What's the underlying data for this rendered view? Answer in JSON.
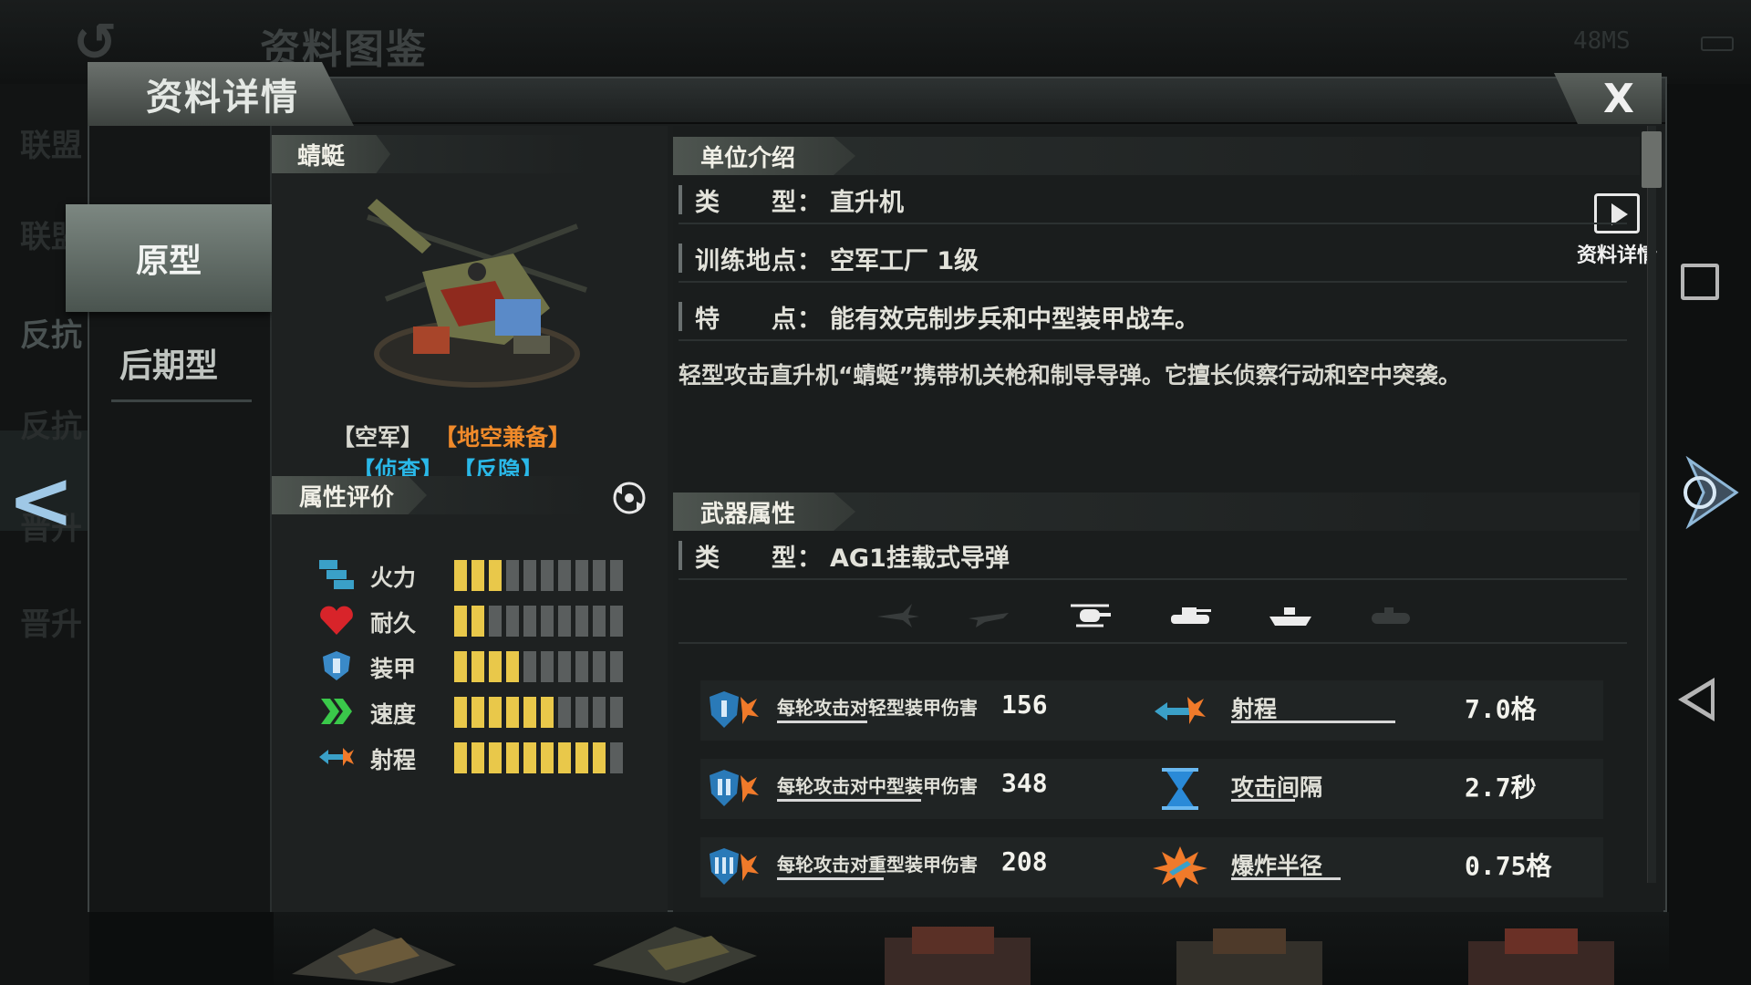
{
  "background": {
    "screen_title": "资料图鉴",
    "status_text": "48MS",
    "left_items": [
      "联盟",
      "联盟",
      "反抗",
      "反抗",
      "晋升",
      "晋升"
    ]
  },
  "panel": {
    "title": "资料详情",
    "close_label": "X"
  },
  "tabs": {
    "prototype": "原型",
    "later": "后期型"
  },
  "unit": {
    "name": "蜻蜓",
    "tags": [
      {
        "text": "【空军】",
        "color": "#f2f2ea"
      },
      {
        "text": "【地空兼备】",
        "color": "#f08a2a"
      },
      {
        "text": "【侦查】",
        "color": "#2ab8e8"
      },
      {
        "text": "【反隐】",
        "color": "#2ab8e8"
      }
    ],
    "rating_title": "属性评价",
    "stats": [
      {
        "label": "火力",
        "icon": "firepower-icon",
        "filled": 3,
        "total": 10
      },
      {
        "label": "耐久",
        "icon": "heart-icon",
        "filled": 2,
        "total": 10
      },
      {
        "label": "装甲",
        "icon": "armor-shield-icon",
        "filled": 4,
        "total": 10
      },
      {
        "label": "速度",
        "icon": "speed-chevron-icon",
        "filled": 6,
        "total": 10
      },
      {
        "label": "射程",
        "icon": "range-arrow-icon",
        "filled": 9,
        "total": 10
      }
    ]
  },
  "intro": {
    "title": "单位介绍",
    "detail_button": "资料详情",
    "rows": [
      {
        "key": "类　　型：",
        "value": "直升机"
      },
      {
        "key": "训练地点：",
        "value": "空军工厂 1级"
      },
      {
        "key": "特　　点：",
        "value": "能有效克制步兵和中型装甲战车。"
      }
    ],
    "description": "轻型攻击直升机“蜻蜓”携带机关枪和制导导弹。它擅长侦察行动和空中突袭。"
  },
  "weapon": {
    "title": "武器属性",
    "type_key": "类　　型：",
    "type_value": "AG1挂载式导弹",
    "targets": [
      {
        "name": "jet-fighter-target-icon",
        "active": false
      },
      {
        "name": "plane-target-icon",
        "active": false
      },
      {
        "name": "helicopter-target-icon",
        "active": true
      },
      {
        "name": "tank-target-icon",
        "active": true
      },
      {
        "name": "ship-target-icon",
        "active": true
      },
      {
        "name": "submarine-target-icon",
        "active": false
      }
    ],
    "rows": [
      {
        "dmg_label": "每轮攻击对轻型装甲伤害",
        "dmg_value": "156",
        "dmg_level": 0.55,
        "attr_label": "射程",
        "attr_value": "7.0格",
        "attr_level": 0.9
      },
      {
        "dmg_label": "每轮攻击对中型装甲伤害",
        "dmg_value": "348",
        "dmg_level": 0.88,
        "attr_label": "攻击间隔",
        "attr_value": "2.7秒",
        "attr_level": 0.35
      },
      {
        "dmg_label": "每轮攻击对重型装甲伤害",
        "dmg_value": "208",
        "dmg_level": 0.65,
        "attr_label": "爆炸半径",
        "attr_value": "0.75格",
        "attr_level": 0.6
      }
    ]
  },
  "colors": {
    "bar_on": "#e9c84a",
    "bar_off": "#5a5e5e",
    "accent_orange": "#f08a2a",
    "accent_cyan": "#2ab8e8"
  }
}
